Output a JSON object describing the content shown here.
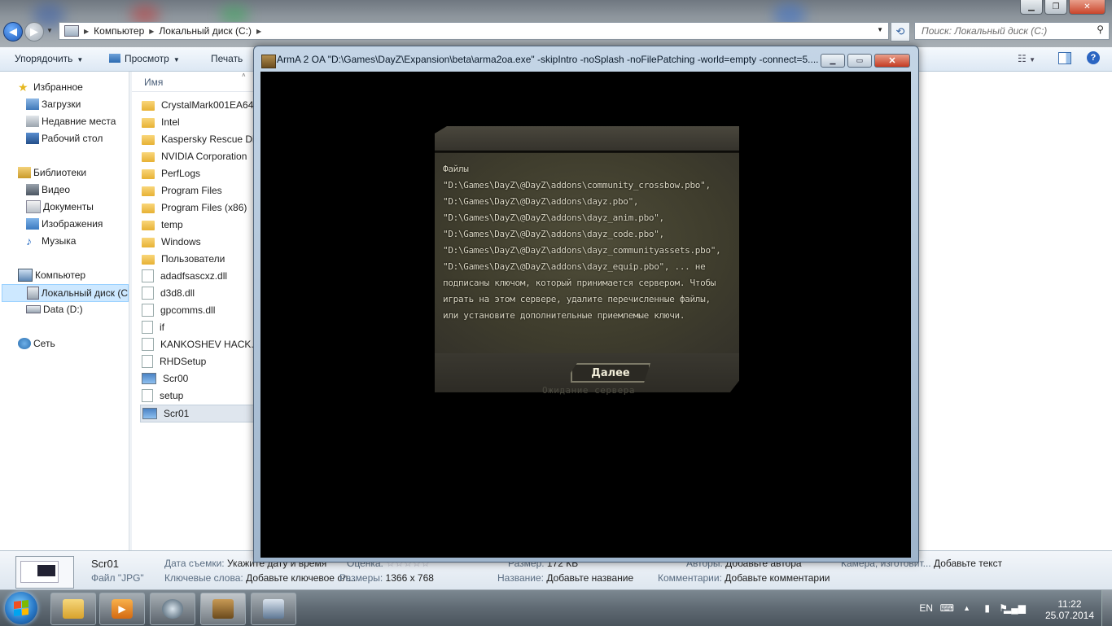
{
  "explorer": {
    "address": {
      "crumbs": [
        "Компьютер",
        "Локальный диск (C:)"
      ]
    },
    "search_placeholder": "Поиск: Локальный диск (C:)",
    "toolbar": {
      "organize": "Упорядочить",
      "view": "Просмотр",
      "print": "Печать"
    },
    "nav": {
      "favorites": "Избранное",
      "downloads": "Загрузки",
      "recent": "Недавние места",
      "desktop": "Рабочий стол",
      "libraries": "Библиотеки",
      "video": "Видео",
      "documents": "Документы",
      "images": "Изображения",
      "music": "Музыка",
      "computer": "Компьютер",
      "local_disk": "Локальный диск (C",
      "data_disk": "Data (D:)",
      "network": "Сеть"
    },
    "filelist": {
      "column_name": "Имя",
      "files": [
        {
          "name": "CrystalMark001EA64D",
          "type": "folder"
        },
        {
          "name": "Intel",
          "type": "folder"
        },
        {
          "name": "Kaspersky Rescue Disk",
          "type": "folder"
        },
        {
          "name": "NVIDIA Corporation",
          "type": "folder"
        },
        {
          "name": "PerfLogs",
          "type": "folder"
        },
        {
          "name": "Program Files",
          "type": "folder"
        },
        {
          "name": "Program Files (x86)",
          "type": "folder"
        },
        {
          "name": "temp",
          "type": "folder"
        },
        {
          "name": "Windows",
          "type": "folder"
        },
        {
          "name": "Пользователи",
          "type": "folder"
        },
        {
          "name": "adadfsascxz.dll",
          "type": "dll"
        },
        {
          "name": "d3d8.dll",
          "type": "dll"
        },
        {
          "name": "gpcomms.dll",
          "type": "dll"
        },
        {
          "name": "if",
          "type": "doc"
        },
        {
          "name": "KANKOSHEV HACK.dll",
          "type": "dll"
        },
        {
          "name": "RHDSetup",
          "type": "doc"
        },
        {
          "name": "Scr00",
          "type": "image"
        },
        {
          "name": "setup",
          "type": "doc"
        },
        {
          "name": "Scr01",
          "type": "image"
        }
      ]
    },
    "details": {
      "filename": "Scr01",
      "filetype": "Файл \"JPG\"",
      "date_label": "Дата съемки:",
      "date_value": "Укажите дату и время",
      "rating_label": "Оценка:",
      "keywords_label": "Ключевые слова:",
      "keywords_value": "Добавьте ключевое сл...",
      "size_label": "Размеры:",
      "size_value": "1366 x 768",
      "filesize_label": "Размер:",
      "filesize_value": "172 КБ",
      "title_label": "Название:",
      "title_value": "Добавьте название",
      "author_label": "Авторы:",
      "author_value": "Добавьте автора",
      "comments_label": "Комментарии:",
      "comments_value": "Добавьте комментарии",
      "camera_label": "Камера, изготовит...",
      "camera_value": "Добавьте текст"
    }
  },
  "arma": {
    "title": "ArmA 2 OA \"D:\\Games\\DayZ\\Expansion\\beta\\arma2oa.exe\"  -skipIntro -noSplash -noFilePatching -world=empty -connect=5....",
    "message": "Файлы\n\"D:\\Games\\DayZ\\@DayZ\\addons\\community_crossbow.pbo\",\n\"D:\\Games\\DayZ\\@DayZ\\addons\\dayz.pbo\",\n\"D:\\Games\\DayZ\\@DayZ\\addons\\dayz_anim.pbo\",\n\"D:\\Games\\DayZ\\@DayZ\\addons\\dayz_code.pbo\",\n\"D:\\Games\\DayZ\\@DayZ\\addons\\dayz_communityassets.pbo\",\n\"D:\\Games\\DayZ\\@DayZ\\addons\\dayz_equip.pbo\", ... не\nподписаны ключом, который принимается сервером. Чтобы\nиграть на этом сервере, удалите перечисленные файлы,\nили установите дополнительные приемлемые ключи.",
    "next_button": "Далее",
    "waiting": "Ожидание сервера"
  },
  "taskbar": {
    "lang": "EN",
    "time": "11:22",
    "date": "25.07.2014"
  }
}
